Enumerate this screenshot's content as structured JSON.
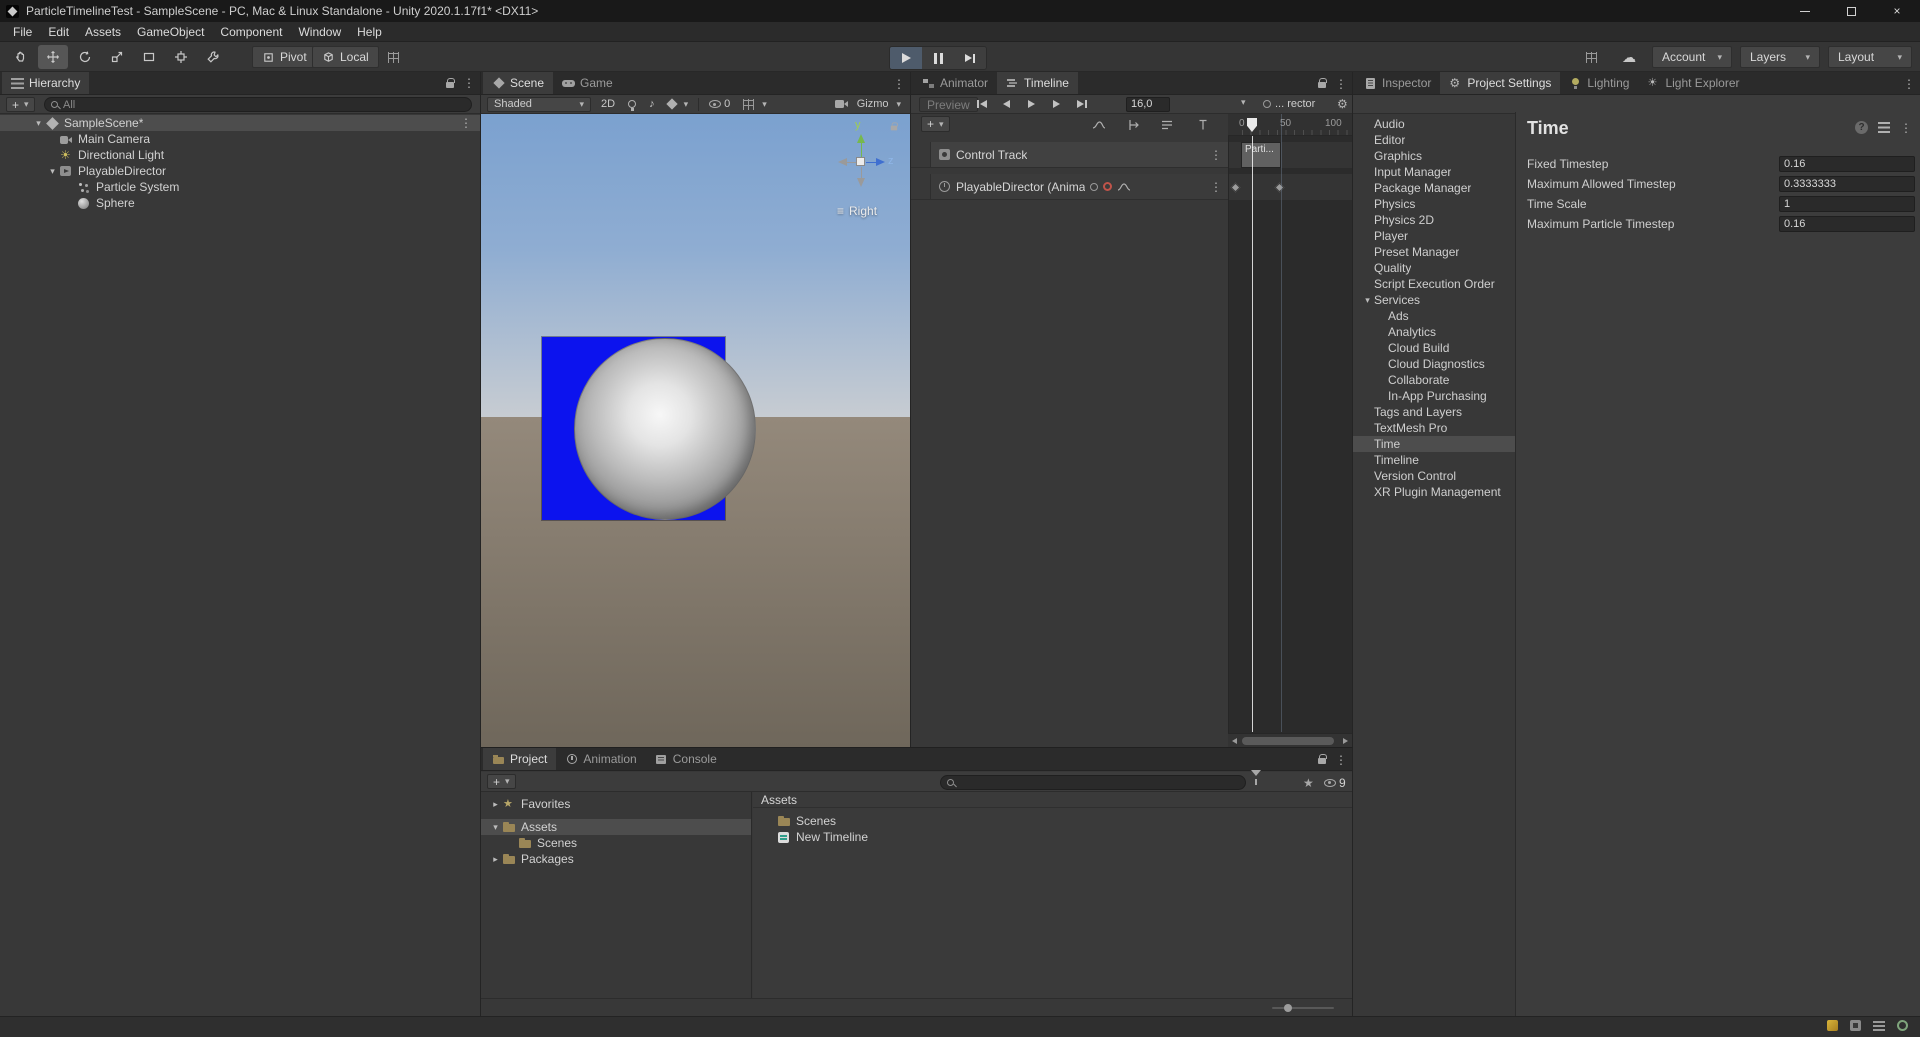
{
  "window": {
    "title": "ParticleTimelineTest - SampleScene - PC, Mac & Linux Standalone - Unity 2020.1.17f1* <DX11>"
  },
  "glyphs": {
    "kebab": "⋮",
    "close": "×",
    "gear": "⚙",
    "cloud": "☁",
    "note": "♪",
    "menu": "≡",
    "help": "?"
  },
  "menu": {
    "items": [
      "File",
      "Edit",
      "Assets",
      "GameObject",
      "Component",
      "Window",
      "Help"
    ]
  },
  "toolbar": {
    "pivot_label": "Pivot",
    "local_label": "Local",
    "account_label": "Account",
    "layers_label": "Layers",
    "layout_label": "Layout"
  },
  "hierarchy": {
    "tab_label": "Hierarchy",
    "add_label": "+",
    "search_placeholder": "All",
    "scene_name": "SampleScene*",
    "items": [
      {
        "label": "Main Camera",
        "icon": "camera",
        "indent": 1
      },
      {
        "label": "Directional Light",
        "icon": "light",
        "indent": 1
      },
      {
        "label": "PlayableDirector",
        "icon": "director",
        "indent": 1,
        "state": "open"
      },
      {
        "label": "Particle System",
        "icon": "particle",
        "indent": 2
      },
      {
        "label": "Sphere",
        "icon": "sphere",
        "indent": 2
      }
    ]
  },
  "scene_view": {
    "tabs": [
      {
        "label": "Scene",
        "icon": "scene-tab",
        "active": true
      },
      {
        "label": "Game",
        "icon": "game-tab"
      }
    ],
    "shading_mode": "Shaded",
    "mode_2d_label": "2D",
    "hidden_count": "0",
    "gizmos_label": "Gizmo",
    "view_orientation": "Right",
    "axis_y": "y",
    "axis_z": "z"
  },
  "timeline": {
    "tabs": [
      {
        "label": "Animator",
        "icon": "animator-tab"
      },
      {
        "label": "Timeline",
        "icon": "timeline-tab",
        "active": true
      }
    ],
    "preview_label": "Preview",
    "frame_value": "16,0",
    "binding_text": "... rector",
    "add_label": "+",
    "ruler_ticks": [
      "0",
      "50",
      "100"
    ],
    "clip_label": "Parti...",
    "tracks": [
      {
        "label": "Control Track"
      },
      {
        "label": "PlayableDirector (Anima"
      }
    ]
  },
  "settings": {
    "tabs": [
      {
        "label": "Inspector",
        "icon": "inspector-tab"
      },
      {
        "label": "Project Settings",
        "icon": "settings-tab",
        "active": true
      },
      {
        "label": "Lighting",
        "icon": "lighting-tab"
      },
      {
        "label": "Light Explorer",
        "icon": "light-explorer-tab"
      }
    ],
    "categories": [
      {
        "label": "Audio"
      },
      {
        "label": "Editor"
      },
      {
        "label": "Graphics"
      },
      {
        "label": "Input Manager"
      },
      {
        "label": "Package Manager"
      },
      {
        "label": "Physics"
      },
      {
        "label": "Physics 2D"
      },
      {
        "label": "Player"
      },
      {
        "label": "Preset Manager"
      },
      {
        "label": "Quality"
      },
      {
        "label": "Script Execution Order"
      },
      {
        "label": "Services",
        "state": "open"
      },
      {
        "label": "Ads",
        "indent": 1
      },
      {
        "label": "Analytics",
        "indent": 1
      },
      {
        "label": "Cloud Build",
        "indent": 1
      },
      {
        "label": "Cloud Diagnostics",
        "indent": 1
      },
      {
        "label": "Collaborate",
        "indent": 1
      },
      {
        "label": "In-App Purchasing",
        "indent": 1
      },
      {
        "label": "Tags and Layers"
      },
      {
        "label": "TextMesh Pro"
      },
      {
        "label": "Time",
        "selected": true
      },
      {
        "label": "Timeline"
      },
      {
        "label": "Version Control"
      },
      {
        "label": "XR Plugin Management"
      }
    ],
    "panel": {
      "title": "Time",
      "fields": [
        {
          "label": "Fixed Timestep",
          "value": "0.16"
        },
        {
          "label": "Maximum Allowed Timestep",
          "value": "0.3333333"
        },
        {
          "label": "Time Scale",
          "value": "1"
        },
        {
          "label": "Maximum Particle Timestep",
          "value": "0.16"
        }
      ]
    }
  },
  "project": {
    "tabs": [
      {
        "label": "Project",
        "icon": "project-tab",
        "active": true
      },
      {
        "label": "Animation",
        "icon": "animation-tab"
      },
      {
        "label": "Console",
        "icon": "console-tab"
      }
    ],
    "add_label": "+",
    "hidden_count": "9",
    "tree": [
      {
        "label": "Favorites",
        "icon": "star",
        "state": "closed",
        "gap": true
      },
      {
        "label": "Assets",
        "icon": "folder",
        "state": "open",
        "selected": true
      },
      {
        "label": "Scenes",
        "icon": "folder",
        "indent": 1
      },
      {
        "label": "Packages",
        "icon": "folder",
        "state": "closed"
      }
    ],
    "breadcrumb": "Assets",
    "items": [
      {
        "label": "Scenes",
        "icon": "folder"
      },
      {
        "label": "New Timeline",
        "icon": "timeline-asset"
      }
    ]
  }
}
